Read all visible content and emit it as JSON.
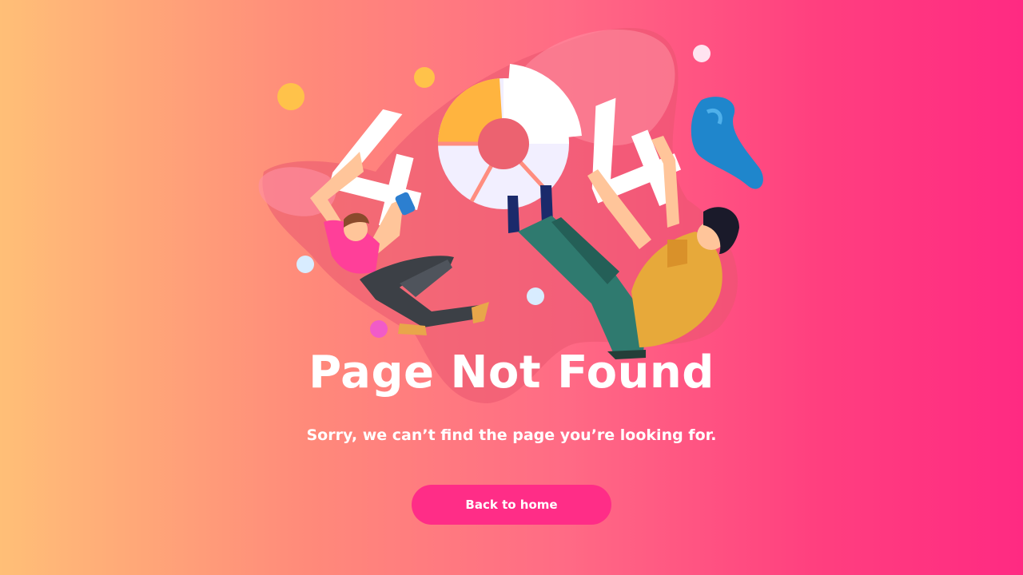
{
  "error": {
    "code_digits": [
      "4",
      "0",
      "4"
    ],
    "title": "Page Not Found",
    "message": "Sorry, we can’t find the page you’re looking for."
  },
  "actions": {
    "back_label": "Back to home"
  },
  "colors": {
    "gradient_start": "#ffbf77",
    "gradient_end": "#ff2a82",
    "button": "#ff2d87",
    "text": "#ffffff"
  }
}
